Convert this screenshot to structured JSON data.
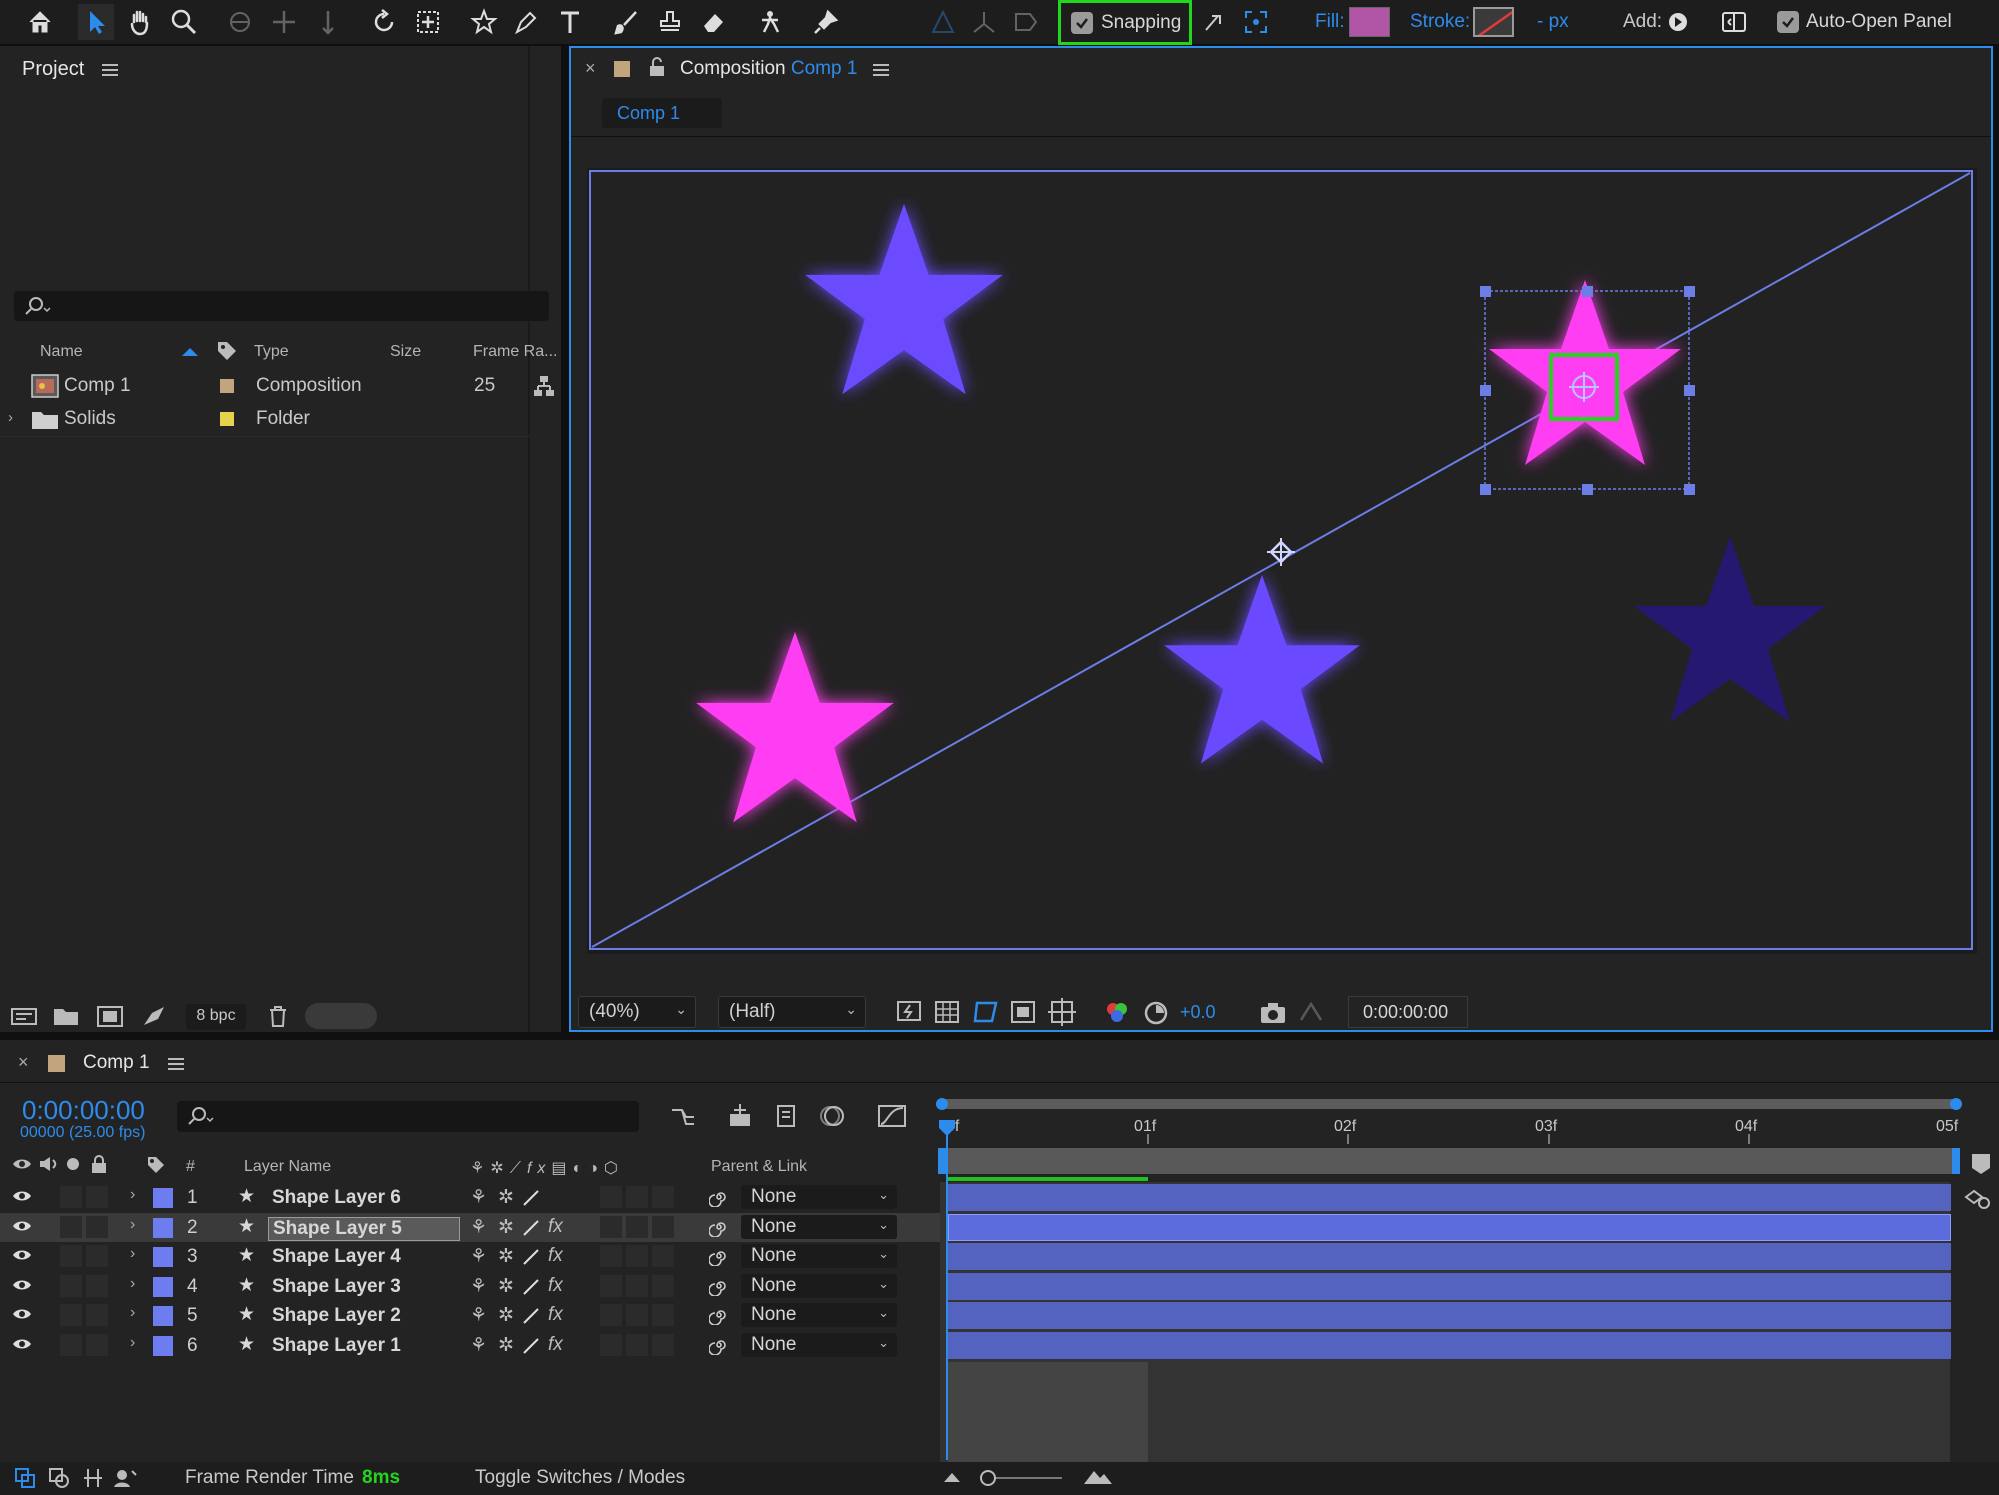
{
  "toolbar": {
    "snapping_label": "Snapping",
    "fill_label": "Fill:",
    "stroke_label": "Stroke:",
    "px_label": "- px",
    "add_label": "Add:",
    "auto_open_label": "Auto-Open Panel",
    "fill_color": "#b155a7"
  },
  "project": {
    "title": "Project",
    "columns": [
      "Name",
      "Type",
      "Size",
      "Frame Ra..."
    ],
    "items": [
      {
        "name": "Comp 1",
        "type": "Composition",
        "frame_rate": "25",
        "color": "#c2a57e"
      },
      {
        "name": "Solids",
        "type": "Folder",
        "frame_rate": "",
        "color": "#e5d14b"
      }
    ],
    "bpc": "8 bpc"
  },
  "viewer": {
    "tab_prefix": "Composition",
    "tab_comp": "Comp 1",
    "subtab": "Comp 1",
    "zoom": "(40%)",
    "resolution": "(Half)",
    "exposure": "+0.0",
    "timecode": "0:00:00:00"
  },
  "timeline": {
    "comp_name": "Comp 1",
    "current_time": "0:00:00:00",
    "frame_info": "00000 (25.00 fps)",
    "headers": {
      "hash": "#",
      "layer_name": "Layer Name",
      "parent": "Parent & Link"
    },
    "ruler": [
      "0f",
      "01f",
      "02f",
      "03f",
      "04f",
      "05f"
    ],
    "layers": [
      {
        "num": "1",
        "name": "Shape Layer 6",
        "parent": "None",
        "fx": false,
        "selected": false
      },
      {
        "num": "2",
        "name": "Shape Layer 5",
        "parent": "None",
        "fx": true,
        "selected": true
      },
      {
        "num": "3",
        "name": "Shape Layer 4",
        "parent": "None",
        "fx": true,
        "selected": false
      },
      {
        "num": "4",
        "name": "Shape Layer 3",
        "parent": "None",
        "fx": true,
        "selected": false
      },
      {
        "num": "5",
        "name": "Shape Layer 2",
        "parent": "None",
        "fx": true,
        "selected": false
      },
      {
        "num": "6",
        "name": "Shape Layer 1",
        "parent": "None",
        "fx": true,
        "selected": false
      }
    ]
  },
  "status": {
    "render_label": "Frame Render Time",
    "render_value": "8ms",
    "toggle_label": "Toggle Switches / Modes"
  }
}
